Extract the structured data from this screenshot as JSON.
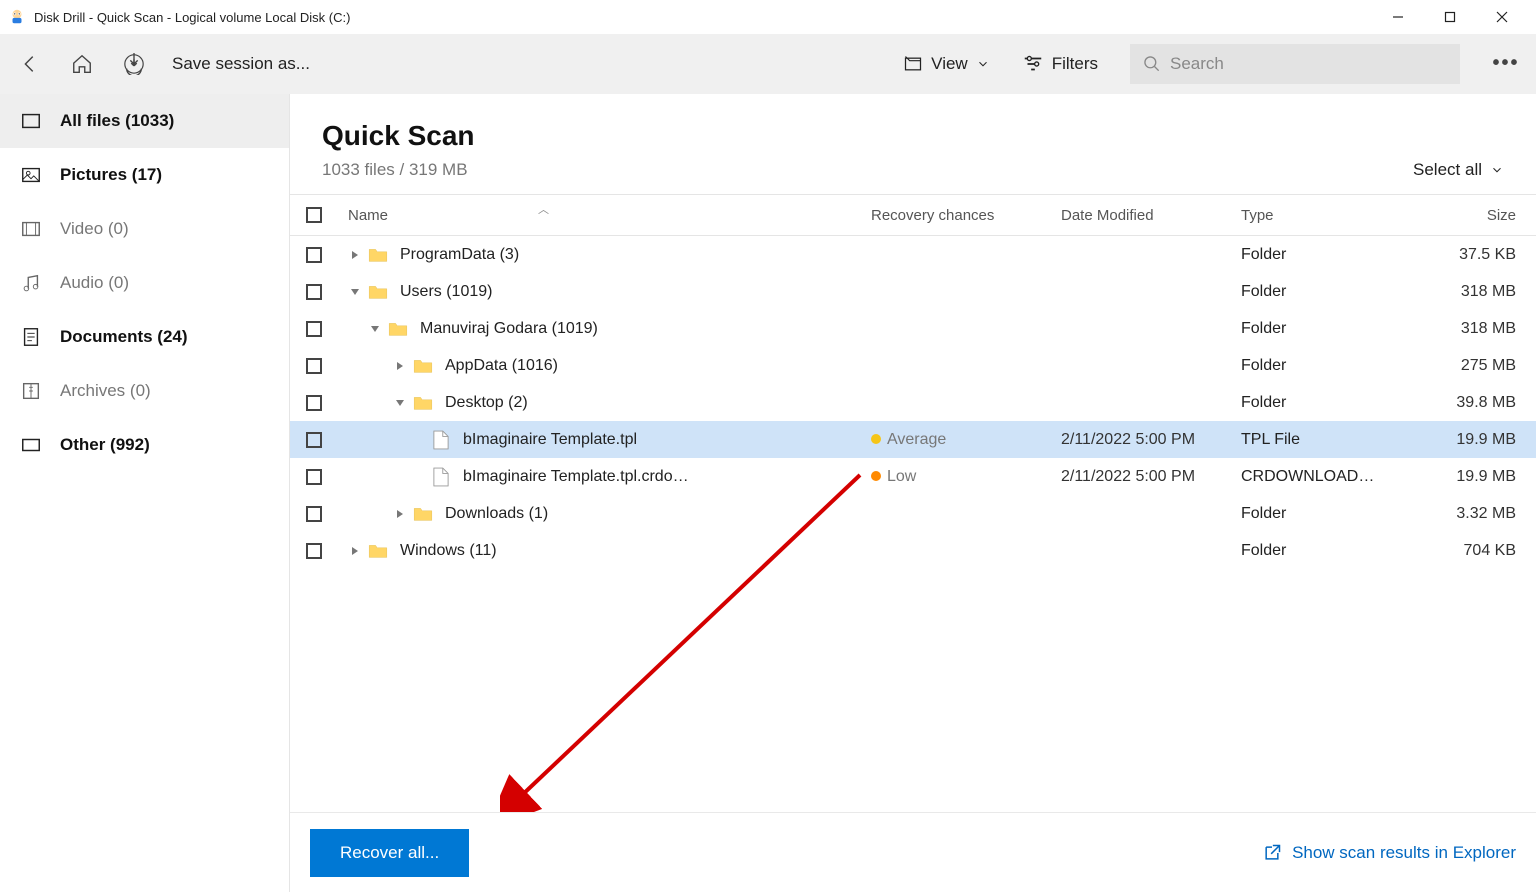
{
  "titlebar": {
    "text": "Disk Drill - Quick Scan - Logical volume Local Disk (C:)"
  },
  "toolbar": {
    "save_session": "Save session as...",
    "view": "View",
    "filters": "Filters",
    "search_placeholder": "Search"
  },
  "sidebar": {
    "items": [
      {
        "label": "All files (1033)",
        "bold": true,
        "active": true,
        "icon": "all-files"
      },
      {
        "label": "Pictures (17)",
        "bold": true,
        "icon": "pictures"
      },
      {
        "label": "Video (0)",
        "bold": false,
        "icon": "video"
      },
      {
        "label": "Audio (0)",
        "bold": false,
        "icon": "audio"
      },
      {
        "label": "Documents (24)",
        "bold": true,
        "icon": "documents"
      },
      {
        "label": "Archives (0)",
        "bold": false,
        "icon": "archives"
      },
      {
        "label": "Other (992)",
        "bold": true,
        "icon": "other"
      }
    ]
  },
  "main": {
    "title": "Quick Scan",
    "subtitle": "1033 files / 319 MB",
    "select_all": "Select all",
    "columns": {
      "name": "Name",
      "recovery": "Recovery chances",
      "date": "Date Modified",
      "type": "Type",
      "size": "Size"
    },
    "rows": [
      {
        "indent": 0,
        "caret": "right",
        "kind": "folder",
        "name": "ProgramData (3)",
        "rec": "",
        "date": "",
        "type": "Folder",
        "size": "37.5 KB"
      },
      {
        "indent": 0,
        "caret": "down",
        "kind": "folder",
        "name": "Users (1019)",
        "rec": "",
        "date": "",
        "type": "Folder",
        "size": "318 MB"
      },
      {
        "indent": 1,
        "caret": "down",
        "kind": "folder",
        "name": "Manuviraj Godara (1019)",
        "rec": "",
        "date": "",
        "type": "Folder",
        "size": "318 MB"
      },
      {
        "indent": 2,
        "caret": "right",
        "kind": "folder",
        "name": "AppData (1016)",
        "rec": "",
        "date": "",
        "type": "Folder",
        "size": "275 MB"
      },
      {
        "indent": 2,
        "caret": "down",
        "kind": "folder",
        "name": "Desktop (2)",
        "rec": "",
        "date": "",
        "type": "Folder",
        "size": "39.8 MB"
      },
      {
        "indent": 3,
        "caret": "blank",
        "kind": "file",
        "name": "bImaginaire Template.tpl",
        "rec": "Average",
        "rec_level": "avg",
        "date": "2/11/2022 5:00 PM",
        "type": "TPL File",
        "size": "19.9 MB",
        "selected": true
      },
      {
        "indent": 3,
        "caret": "blank",
        "kind": "file",
        "name": "bImaginaire Template.tpl.crdo…",
        "rec": "Low",
        "rec_level": "low",
        "date": "2/11/2022 5:00 PM",
        "type": "CRDOWNLOAD…",
        "size": "19.9 MB"
      },
      {
        "indent": 2,
        "caret": "right",
        "kind": "folder",
        "name": "Downloads (1)",
        "rec": "",
        "date": "",
        "type": "Folder",
        "size": "3.32 MB"
      },
      {
        "indent": 0,
        "caret": "right",
        "kind": "folder",
        "name": "Windows (11)",
        "rec": "",
        "date": "",
        "type": "Folder",
        "size": "704 KB"
      }
    ],
    "recover_btn": "Recover all...",
    "explorer_link": "Show scan results in Explorer"
  }
}
